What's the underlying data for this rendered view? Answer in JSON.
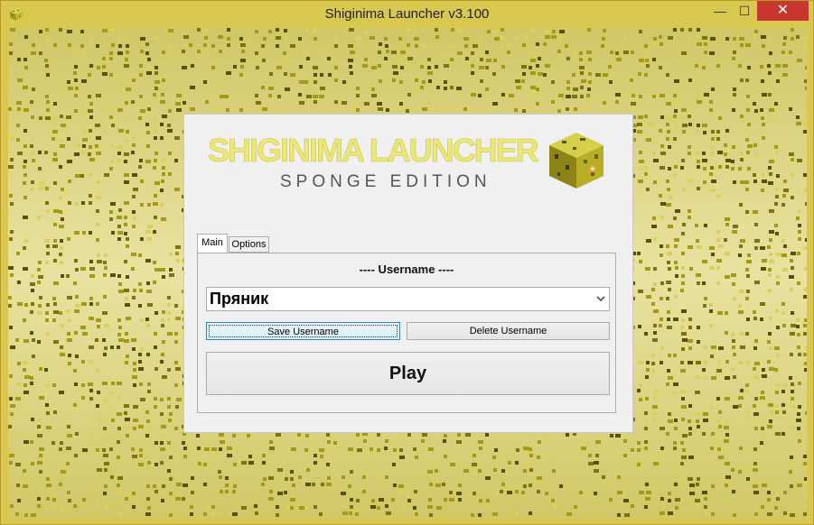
{
  "window": {
    "title": "Shiginima Launcher v3.100",
    "controls": {
      "minimize": "—",
      "maximize": "☐",
      "close": "✕"
    }
  },
  "logo": {
    "line1": "SHIGINIMA LAUNCHER",
    "line2": "SPONGE EDITION"
  },
  "tabs": [
    {
      "label": "Main",
      "selected": true
    },
    {
      "label": "Options",
      "selected": false
    }
  ],
  "main": {
    "username_label": "---- Username ----",
    "username_value": "Пряник",
    "save_button": "Save Username",
    "delete_button": "Delete Username",
    "play_button": "Play"
  },
  "colors": {
    "background": "#e6e09a",
    "pixel_dark": "#55520a",
    "pixel_mid": "#a49a18",
    "pixel_light": "#d8d060",
    "close_button": "#c7372f",
    "panel": "#f0f0f0"
  },
  "icons": {
    "app": "sponge-block-icon",
    "dropdown": "chevron-down-icon",
    "logo_cube": "sponge-cube-icon"
  }
}
